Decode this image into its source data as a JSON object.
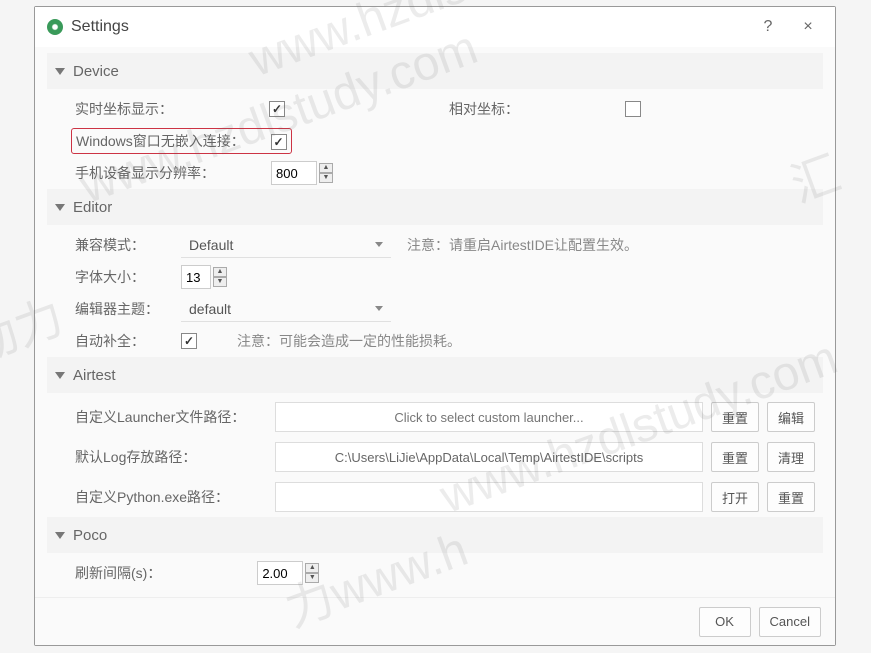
{
  "window": {
    "title": "Settings",
    "help": "?",
    "close": "×"
  },
  "device": {
    "header": "Device",
    "realtime_coord_label": "实时坐标显示：",
    "realtime_coord_checked": true,
    "relative_coord_label": "相对坐标：",
    "relative_coord_checked": false,
    "windows_noembed_label": "Windows窗口无嵌入连接：",
    "windows_noembed_checked": true,
    "phone_resolution_label": "手机设备显示分辨率：",
    "phone_resolution_value": "800"
  },
  "editor": {
    "header": "Editor",
    "compat_mode_label": "兼容模式：",
    "compat_mode_value": "Default",
    "compat_mode_note": "注意：请重启AirtestIDE让配置生效。",
    "font_size_label": "字体大小：",
    "font_size_value": "13",
    "theme_label": "编辑器主题：",
    "theme_value": "default",
    "autocomplete_label": "自动补全：",
    "autocomplete_checked": true,
    "autocomplete_note": "注意：可能会造成一定的性能损耗。"
  },
  "airtest": {
    "header": "Airtest",
    "launcher_label": "自定义Launcher文件路径：",
    "launcher_placeholder": "Click to select custom launcher...",
    "launcher_reset": "重置",
    "launcher_edit": "编辑",
    "log_label": "默认Log存放路径：",
    "log_value": "C:\\Users\\LiJie\\AppData\\Local\\Temp\\AirtestIDE\\scripts",
    "log_reset": "重置",
    "log_clean": "清理",
    "python_label": "自定义Python.exe路径：",
    "python_open": "打开",
    "python_reset": "重置"
  },
  "poco": {
    "header": "Poco",
    "refresh_label": "刷新间隔(s)：",
    "refresh_value": "2.00"
  },
  "footer": {
    "ok": "OK",
    "cancel": "Cancel"
  },
  "watermarks": {
    "wm1": "www.hzdlstudy.com",
    "wm2": "www.hzdlstudy.com",
    "wm3": "www.hzdlstudy.co",
    "wm4": "力www.h",
    "wm5": "智动力",
    "wm6": "汇"
  }
}
